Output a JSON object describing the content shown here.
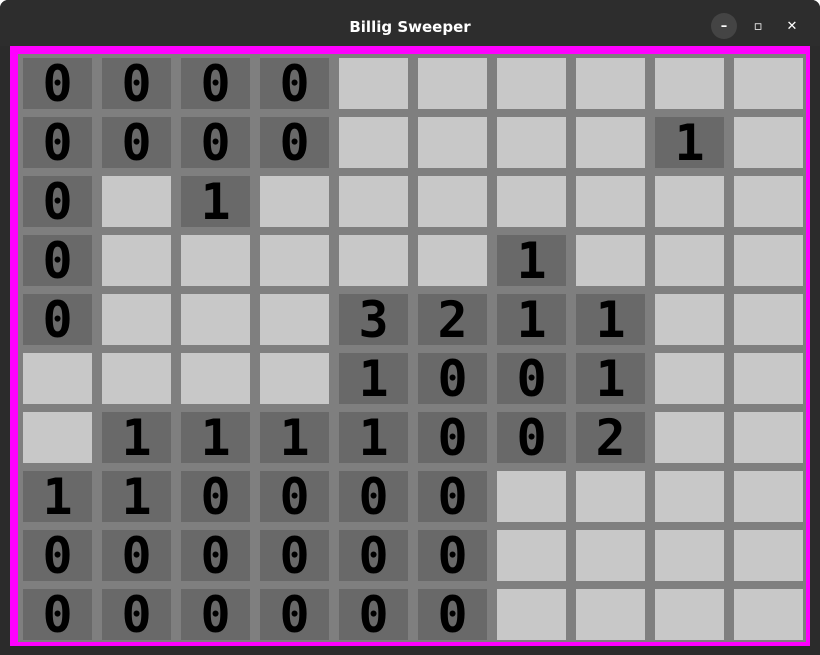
{
  "window": {
    "title": "Billig Sweeper",
    "buttons": {
      "minimize": "–",
      "maximize": "▫",
      "close": "✕"
    },
    "frame_color": "#ff00ff"
  },
  "colors": {
    "covered": "#c8c8c8",
    "revealed": "#696969",
    "grid": "#7f7f7f"
  },
  "board": {
    "rows": [
      [
        "0",
        "0",
        "0",
        "0",
        null,
        null,
        null,
        null,
        null,
        null
      ],
      [
        "0",
        "0",
        "0",
        "0",
        null,
        null,
        null,
        null,
        "1",
        null
      ],
      [
        "0",
        null,
        "1",
        null,
        null,
        null,
        null,
        null,
        null,
        null
      ],
      [
        "0",
        null,
        null,
        null,
        null,
        null,
        "1",
        null,
        null,
        null
      ],
      [
        "0",
        null,
        null,
        null,
        "3",
        "2",
        "1",
        "1",
        null,
        null
      ],
      [
        null,
        null,
        null,
        null,
        "1",
        "0",
        "0",
        "1",
        null,
        null
      ],
      [
        null,
        "1",
        "1",
        "1",
        "1",
        "0",
        "0",
        "2",
        null,
        null
      ],
      [
        "1",
        "1",
        "0",
        "0",
        "0",
        "0",
        null,
        null,
        null,
        null
      ],
      [
        "0",
        "0",
        "0",
        "0",
        "0",
        "0",
        null,
        null,
        null,
        null
      ],
      [
        "0",
        "0",
        "0",
        "0",
        "0",
        "0",
        null,
        null,
        null,
        null
      ]
    ]
  }
}
